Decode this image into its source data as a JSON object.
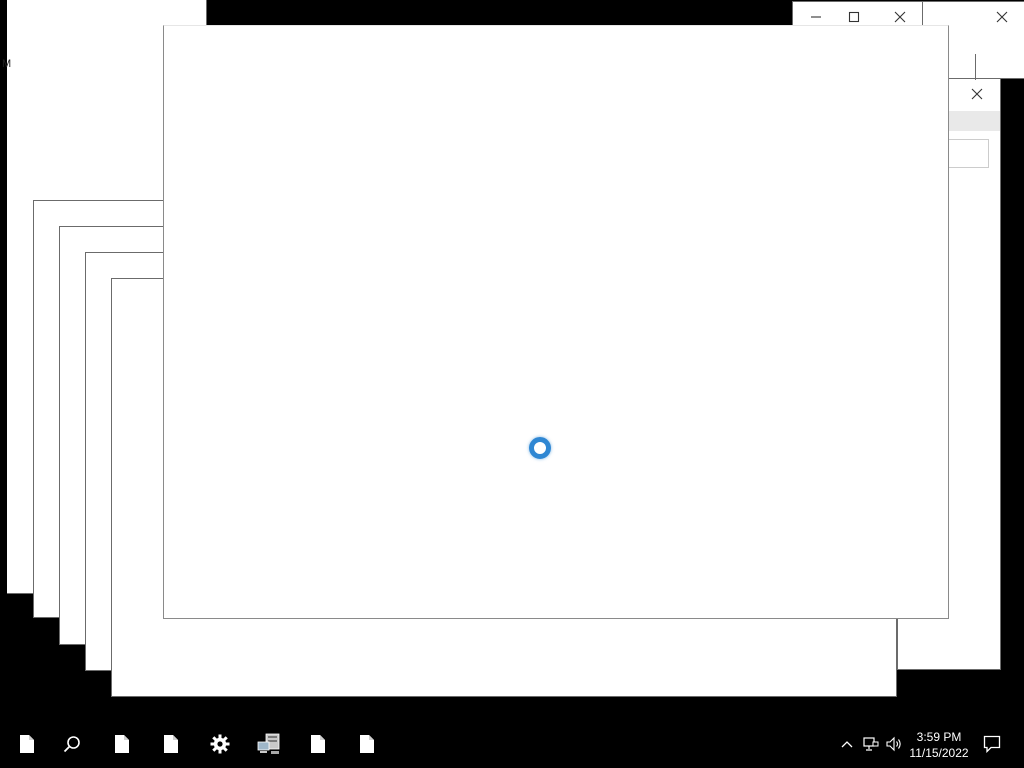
{
  "desktop": {
    "side_label": "M"
  },
  "windows": {
    "back_window": {
      "minimize_icon": "minimize-icon",
      "maximize_icon": "maximize-icon",
      "close_icon": "close-icon"
    },
    "far_right_window": {
      "close_icon": "close-icon"
    },
    "dialog_window": {
      "close_icon": "close-icon"
    },
    "front_window": {
      "loading_icon": "loading-spinner-icon"
    }
  },
  "taskbar": {
    "items": [
      {
        "name": "taskbar-document-icon-1",
        "icon": "document-icon"
      },
      {
        "name": "taskbar-search-icon",
        "icon": "search-icon"
      },
      {
        "name": "taskbar-document-icon-2",
        "icon": "document-icon"
      },
      {
        "name": "taskbar-document-icon-3",
        "icon": "document-icon"
      },
      {
        "name": "taskbar-settings-icon",
        "icon": "gear-icon"
      },
      {
        "name": "taskbar-network-computer-icon",
        "icon": "network-computer-icon"
      },
      {
        "name": "taskbar-document-icon-4",
        "icon": "document-icon"
      },
      {
        "name": "taskbar-document-icon-5",
        "icon": "document-icon"
      }
    ],
    "tray": {
      "chevron_icon": "chevron-up-icon",
      "network_icon": "network-icon",
      "volume_icon": "volume-icon",
      "notification_icon": "notification-icon"
    },
    "clock": {
      "time": "3:59 PM",
      "date": "11/15/2022"
    }
  },
  "colors": {
    "taskbar_bg": "#000000",
    "window_bg": "#ffffff",
    "window_border": "#6b6b6b",
    "spinner_accent": "#2f87d3"
  }
}
